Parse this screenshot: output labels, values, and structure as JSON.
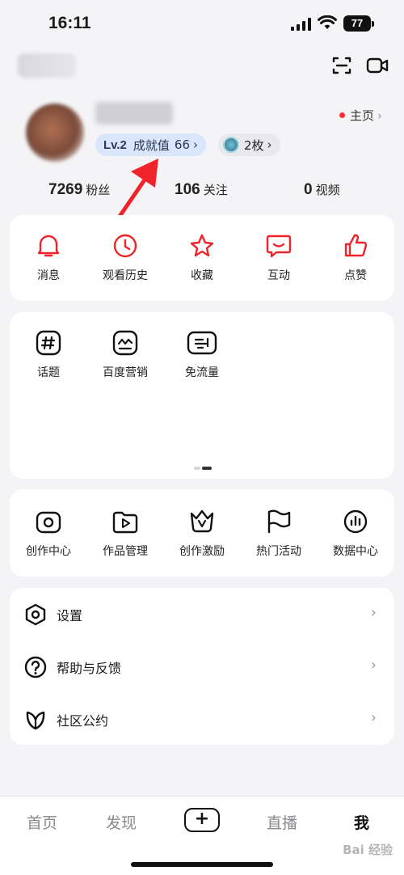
{
  "status_bar": {
    "time": "16:11",
    "battery": "77"
  },
  "profile": {
    "homepage_label": "主页",
    "level_label": "Lv.2",
    "achievement_label": "成就值",
    "achievement_value": "66",
    "badge_count": "2枚"
  },
  "stats": [
    {
      "value": "7269",
      "label": "粉丝"
    },
    {
      "value": "106",
      "label": "关注"
    },
    {
      "value": "0",
      "label": "视频"
    }
  ],
  "quick_actions": [
    {
      "label": "消息",
      "icon": "bell-icon"
    },
    {
      "label": "观看历史",
      "icon": "clock-icon"
    },
    {
      "label": "收藏",
      "icon": "star-icon"
    },
    {
      "label": "互动",
      "icon": "chat-icon"
    },
    {
      "label": "点赞",
      "icon": "thumbs-up-icon"
    }
  ],
  "services": [
    {
      "label": "话题",
      "icon": "hashtag-icon"
    },
    {
      "label": "百度营销",
      "icon": "marketing-icon"
    },
    {
      "label": "免流量",
      "icon": "ticket-icon"
    }
  ],
  "creator_tools": [
    {
      "label": "创作中心",
      "icon": "camera-icon"
    },
    {
      "label": "作品管理",
      "icon": "play-folder-icon"
    },
    {
      "label": "创作激励",
      "icon": "crown-icon"
    },
    {
      "label": "热门活动",
      "icon": "flag-icon"
    },
    {
      "label": "数据中心",
      "icon": "chart-icon"
    }
  ],
  "settings_list": [
    {
      "label": "设置",
      "icon": "settings-hex-icon"
    },
    {
      "label": "帮助与反馈",
      "icon": "help-icon"
    },
    {
      "label": "社区公约",
      "icon": "leaf-icon"
    }
  ],
  "bottom_nav": [
    {
      "label": "首页"
    },
    {
      "label": "发现"
    },
    {
      "label": "+"
    },
    {
      "label": "直播"
    },
    {
      "label": "我"
    }
  ],
  "watermark": "Bai 经验",
  "colors": {
    "accent_red": "#ff2d3b",
    "level_pill_bg": "#d9e6fb",
    "page_bg": "#f4f4f6"
  }
}
